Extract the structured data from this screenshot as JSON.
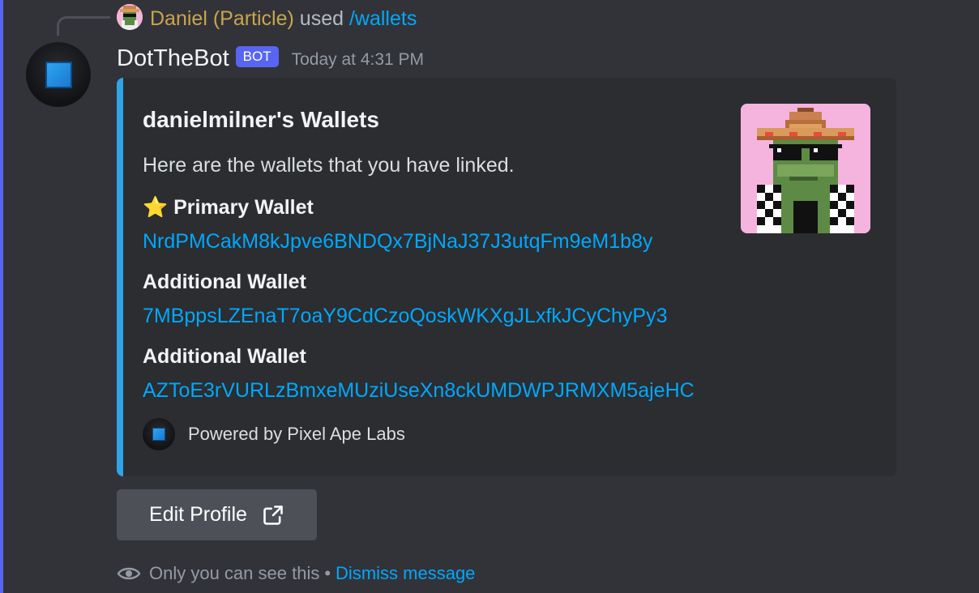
{
  "reply": {
    "user": "Daniel (Particle)",
    "used_text": "used",
    "command": "/wallets"
  },
  "message": {
    "author": "DotTheBot",
    "tag": "BOT",
    "timestamp": "Today at 4:31 PM"
  },
  "embed": {
    "accent_color": "#2fa4e9",
    "title": "danielmilner's Wallets",
    "description": "Here are the wallets that you have linked.",
    "fields": [
      {
        "icon": "star-icon",
        "name": "Primary Wallet",
        "value": "NrdPMCakM8kJpve6BNDQx7BjNaJ37J3utqFm9eM1b8y"
      },
      {
        "name": "Additional Wallet",
        "value": "7MBppsLZEnaT7oaY9CdCzoQoskWKXgJLxfkJCyChyPy3"
      },
      {
        "name": "Additional Wallet",
        "value": "AZToE3rVURLzBmxeMUziUseXn8ckUMDWPJRMXM5ajeHC"
      }
    ],
    "footer": "Powered by Pixel Ape Labs"
  },
  "button": {
    "label": "Edit Profile",
    "icon": "external-link-icon"
  },
  "notice": {
    "text": "Only you can see this",
    "separator": "•",
    "dismiss": "Dismiss message"
  },
  "colors": {
    "background": "#323339",
    "bot_tag": "#5865f2",
    "link": "#00a8fc",
    "reply_user": "#c9a64b"
  }
}
